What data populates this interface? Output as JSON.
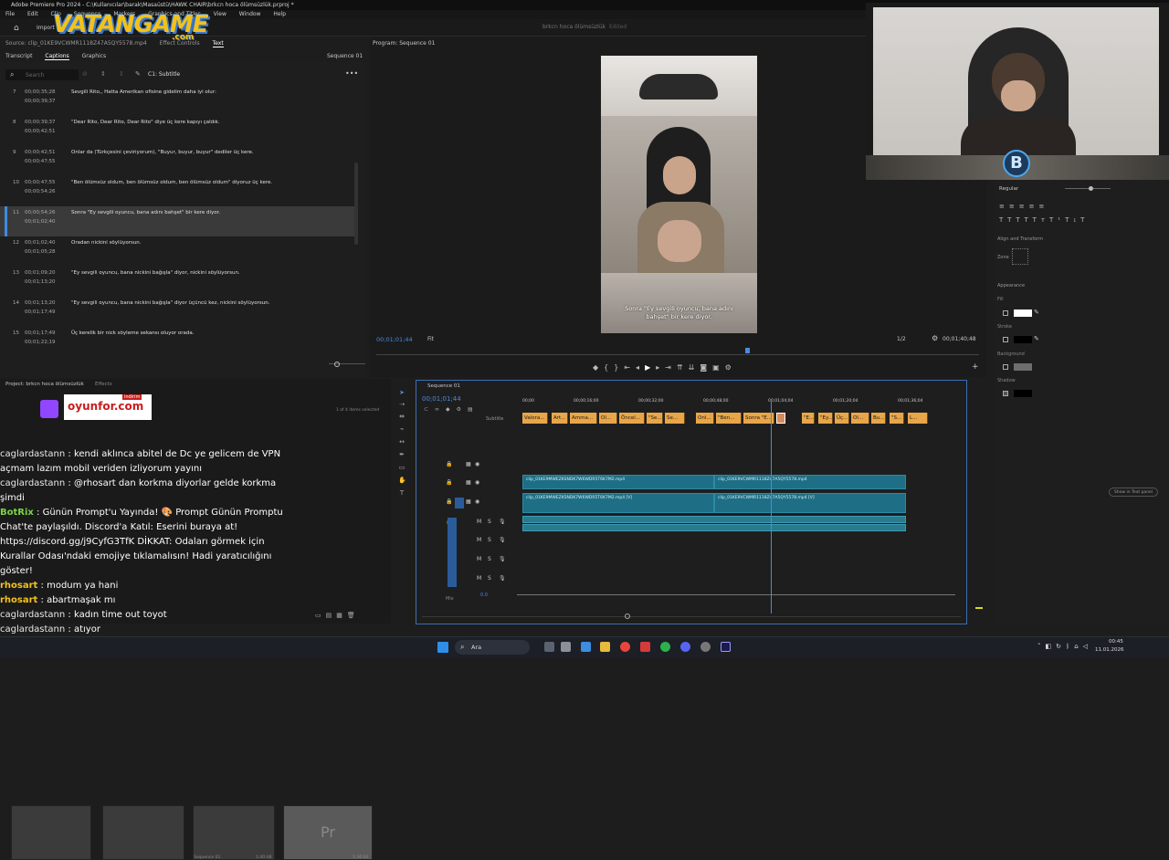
{
  "app": {
    "title": "Adobe Premiere Pro 2024 - C:\\Kullanıcılar\\barak\\Masaüstü\\HAWK CHAIR\\brkcn hoca ölümsüzlük.prproj *"
  },
  "menu": [
    "File",
    "Edit",
    "Clip",
    "Sequence",
    "Markers",
    "Graphics and Titles",
    "View",
    "Window",
    "Help"
  ],
  "watermark": {
    "brand": "VATANGAME",
    "suffix": ".com"
  },
  "source_bar": {
    "source_label": "Source: clip_01KE9VCWMR1118Z47A5QY5578.mp4",
    "effect_controls": "Effect Controls",
    "text_tab": "Text",
    "import_label": "Import"
  },
  "caption_panel": {
    "tabs": [
      "Transcript",
      "Captions",
      "Graphics"
    ],
    "active_tab": "Captions",
    "sequence_label": "Sequence 01",
    "search_placeholder": "Search",
    "track_label": "C1: Subtitle",
    "rows": [
      {
        "num": "7",
        "in": "00;00;35;28",
        "out": "00;00;39;37",
        "text": "Sevgili Rito,, Hatta Amerikan ofisine gidelim daha iyi olur:"
      },
      {
        "num": "8",
        "in": "00;00;39;37",
        "out": "00;00;42;51",
        "text": "\"Dear Rito, Dear Rito, Dear Rito\" diye üç kere kapıyı çaldık."
      },
      {
        "num": "9",
        "in": "00;00;42;51",
        "out": "00;00;47;55",
        "text": "Onlar da (Türkçesini çeviriyorum), \"Buyur, buyur, buyur\" dediler üç kere."
      },
      {
        "num": "10",
        "in": "00;00;47;55",
        "out": "00;00;54;26",
        "text": "\"Ben ölümsüz oldum, ben ölümsüz oldum, ben ölümsüz oldum\" diyoruz üç kere."
      },
      {
        "num": "11",
        "in": "00;00;54;26",
        "out": "00;01;02;40",
        "text": "Sonra \"Ey sevgili oyuncu, bana adını bahşet\" bir kere diyor."
      },
      {
        "num": "12",
        "in": "00;01;02;40",
        "out": "00;01;05;28",
        "text": "Oradan nickini söylüyorsun."
      },
      {
        "num": "13",
        "in": "00;01;09;20",
        "out": "00;01;13;20",
        "text": "\"Ey sevgili oyuncu, bana nickini bağışla\" diyor, nickini söylüyorsun."
      },
      {
        "num": "14",
        "in": "00;01;13;20",
        "out": "00;01;17;49",
        "text": "\"Ey sevgili oyuncu, bana nickini bağışla\" diyor üçüncü kez, nickini söylüyorsun."
      },
      {
        "num": "15",
        "in": "00;01;17;49",
        "out": "00;01;22;19",
        "text": "Üç kerelik bir nick söyleme sekansı oluyor orada."
      }
    ],
    "selected_index": 4
  },
  "program_monitor": {
    "title": "Program: Sequence 01",
    "center_title": "brkcn hoca ölümsüzlük",
    "edited": "Edited",
    "timecode": "00;01;01;44",
    "fit": "Fit",
    "fraction": "1/2",
    "duration": "00;01;40;48",
    "subtitle": "Sonra \"Ey sevgili oyuncu, bana adını bahşet\" bir kere diyor."
  },
  "props_panel": {
    "font_style": "Regular",
    "align_transform": "Align and Transform",
    "appearance": "Appearance",
    "fill": "Fill",
    "stroke": "Stroke",
    "background": "Background",
    "shadow": "Shadow",
    "show_text_panel": "Show in Text panel",
    "zone": "Zone"
  },
  "project_panel": {
    "title": "Project: brkcn hoca ölümsüzlük",
    "effects": "Effects",
    "items_selected": "1 of 4 items selected",
    "sequence": "Sequence 01",
    "durations": [
      "1:40:48",
      "1:36:60"
    ]
  },
  "ad": {
    "text": "oyunfor.com",
    "badge": "indirim"
  },
  "chat": [
    {
      "user": "caglardastann",
      "msg": "kendi aklınca abitel de Dc ye gelicem de VPN açmam lazım mobil veriden izliyorum yayını",
      "type": "user"
    },
    {
      "user": "caglardastann",
      "msg": "@rhosart dan korkma diyorlar gelde korkma şimdi",
      "type": "user"
    },
    {
      "user": "BotRix",
      "msg": "Günün Prompt'u Yayında! 🎨 Prompt Günün Promptu Chat'te paylaşıldı. Discord'a Katıl: Eserini buraya at! https://discord.gg/j9CyfG3TfK DİKKAT: Odaları görmek için Kurallar Odası'ndaki emojiye tıklamalısın! Hadi yaratıcılığını göster!",
      "type": "bot"
    },
    {
      "user": "rhosart",
      "msg": "modum ya hani",
      "type": "bot"
    },
    {
      "user": "rhosart",
      "msg": "abartmaşak mı",
      "type": "bot"
    },
    {
      "user": "caglardastann",
      "msg": "kadın time out toyot",
      "type": "user"
    },
    {
      "user": "caglardastann",
      "msg": "atıyor",
      "type": "user"
    }
  ],
  "timeline": {
    "sequence_tab": "Sequence 01",
    "timecode": "00;01;01;44",
    "ruler": [
      "00;00",
      "00;00;16;00",
      "00;00;32;00",
      "00;00;48;00",
      "00;01;04;04",
      "00;01;20;04",
      "00;01;36;04"
    ],
    "subtitle_track": "Subtitle",
    "caption_clips": [
      "Valora...",
      "Art...",
      "Amma...",
      "Ol...",
      "Öncel...",
      "\"Se...",
      "Se...",
      "Onl...",
      "\"Ben...",
      "Sonra \"E...",
      "",
      "\"E...",
      "\"Ey...",
      "Üç...",
      "Ol...",
      "Bu...",
      "\"S...",
      "L..."
    ],
    "video_clips": [
      {
        "v2": "clip_01KE9MWEZKSNDK7W6WDR5T6K7M2.mp4",
        "v1": "clip_01KE9MWEZKSNDK7W6WDR5T6K7M2.mp4 [V]"
      },
      {
        "v2": "clip_01KE9VCWMR1118Z47A5QY5578.mp4",
        "v1": "clip_01KE9VCWMR1118Z47A5QY5578.mp4 [V]"
      }
    ],
    "tracks": [
      "V3",
      "V2",
      "V1",
      "A1",
      "A2",
      "A3",
      "A4"
    ],
    "mix": "Mix",
    "mix_value": "0.0"
  },
  "taskbar": {
    "search": "Ara",
    "time": "00:45",
    "date": "11.01.2026"
  },
  "colors": {
    "caption_clip": "#e8a648",
    "video_clip": "#1e6f86",
    "playhead": "#4a8be0",
    "accent": "#3e8ce0"
  }
}
